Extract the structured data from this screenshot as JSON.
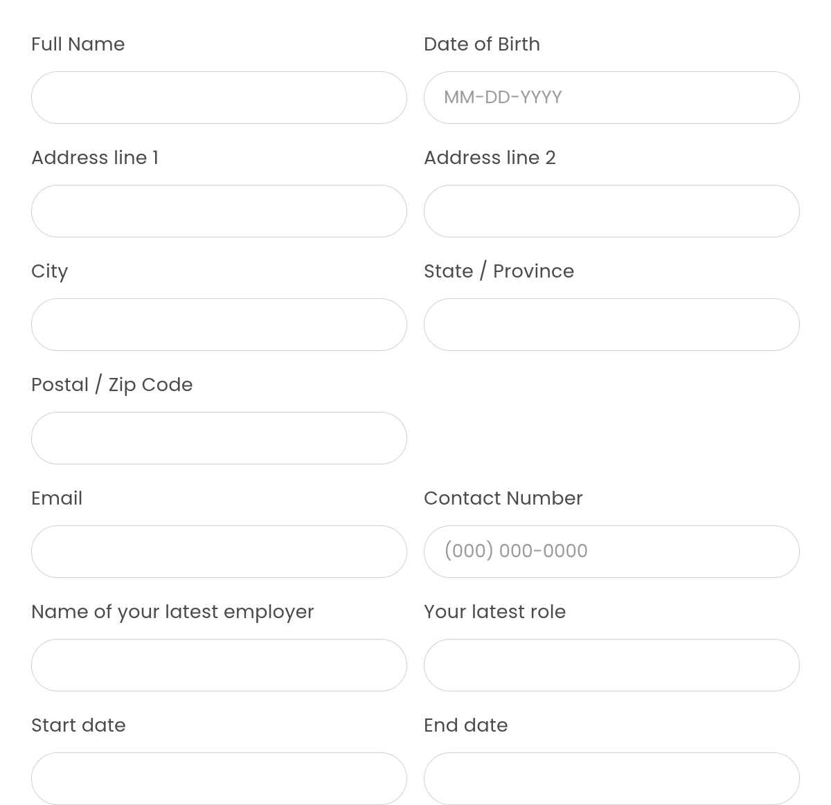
{
  "fields": {
    "fullName": {
      "label": "Full Name",
      "placeholder": ""
    },
    "dob": {
      "label": "Date of Birth",
      "placeholder": "MM-DD-YYYY"
    },
    "address1": {
      "label": "Address line 1",
      "placeholder": ""
    },
    "address2": {
      "label": "Address line 2",
      "placeholder": ""
    },
    "city": {
      "label": "City",
      "placeholder": ""
    },
    "state": {
      "label": "State / Province",
      "placeholder": ""
    },
    "postal": {
      "label": "Postal / Zip Code",
      "placeholder": ""
    },
    "email": {
      "label": "Email",
      "placeholder": ""
    },
    "contact": {
      "label": "Contact Number",
      "placeholder": "(000) 000-0000"
    },
    "employer": {
      "label": "Name of your latest employer",
      "placeholder": ""
    },
    "role": {
      "label": "Your latest role",
      "placeholder": ""
    },
    "startDate": {
      "label": "Start date",
      "placeholder": ""
    },
    "endDate": {
      "label": "End date",
      "placeholder": ""
    }
  }
}
